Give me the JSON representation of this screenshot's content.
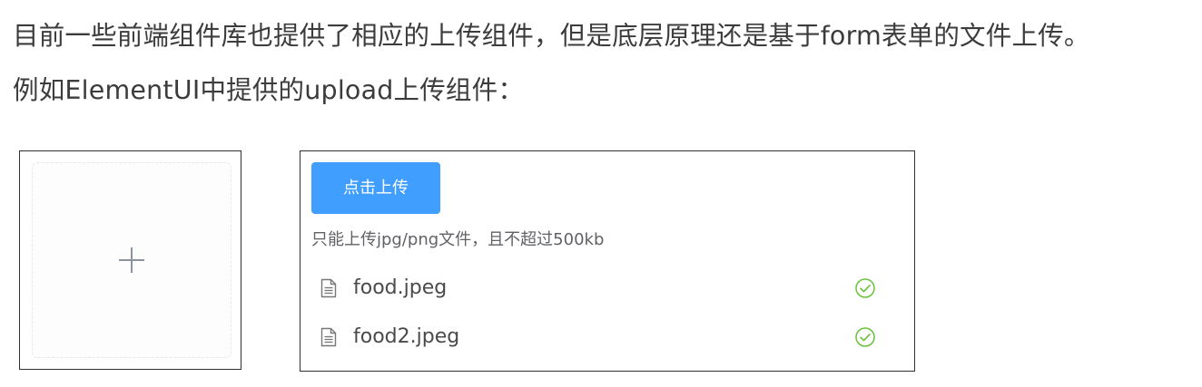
{
  "article": {
    "paragraph_1": "目前一些前端组件库也提供了相应的上传组件，但是底层原理还是基于form表单的文件上传。",
    "paragraph_2": "例如ElementUI中提供的upload上传组件："
  },
  "card_upload": {
    "icon": "plus-icon"
  },
  "list_upload": {
    "button_label": "点击上传",
    "tip": "只能上传jpg/png文件，且不超过500kb",
    "files": [
      {
        "name": "food.jpeg",
        "icon": "document-icon",
        "status_icon": "circle-check-icon",
        "status_color": "#67c23a"
      },
      {
        "name": "food2.jpeg",
        "icon": "document-icon",
        "status_icon": "circle-check-icon",
        "status_color": "#67c23a"
      }
    ]
  },
  "colors": {
    "primary": "#409eff",
    "success": "#67c23a",
    "text": "#3c3c3c"
  }
}
